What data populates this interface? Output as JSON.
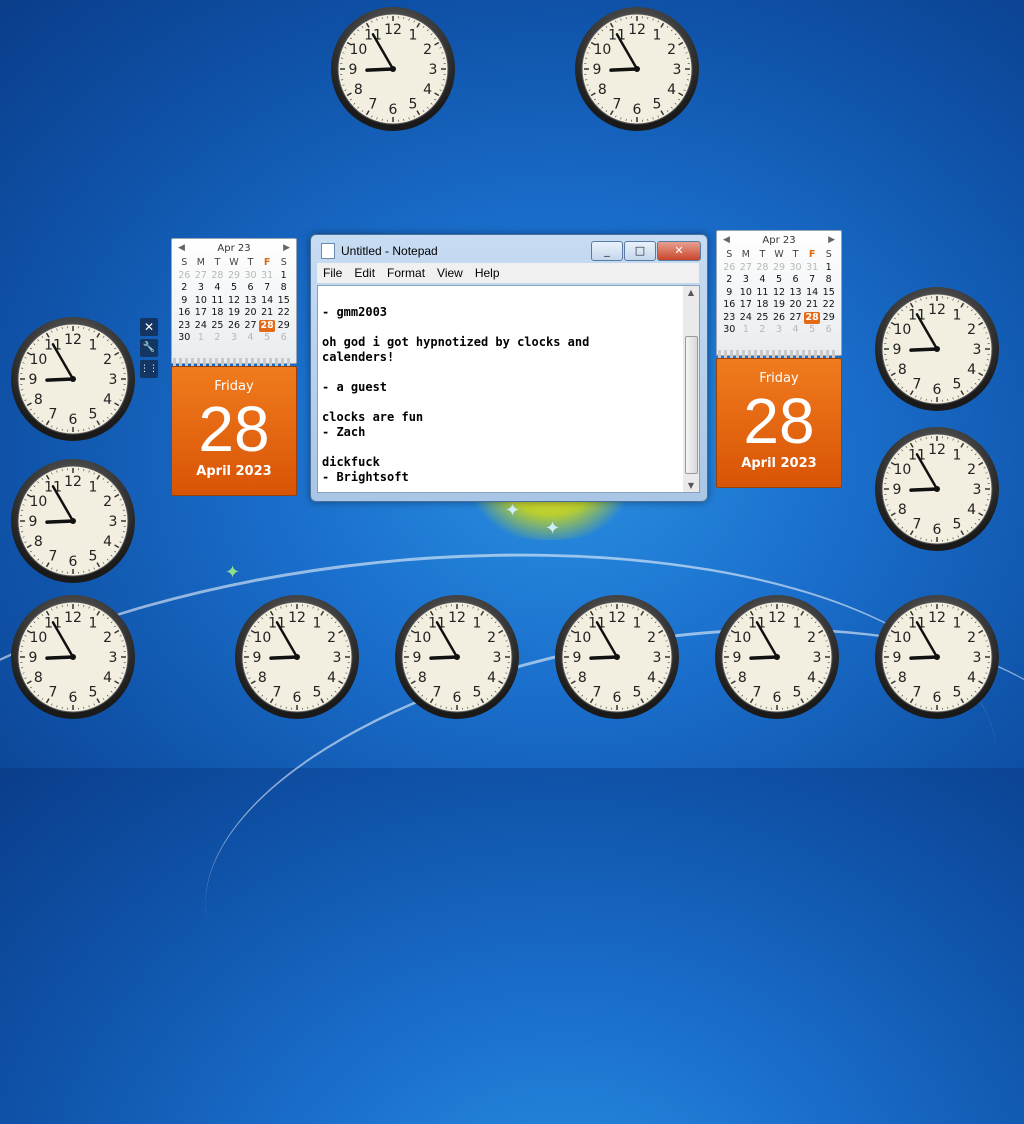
{
  "clock_numerals": [
    "12",
    "1",
    "2",
    "3",
    "4",
    "5",
    "6",
    "7",
    "8",
    "9",
    "10",
    "11"
  ],
  "clock_time": {
    "hour": 8,
    "minute": 55
  },
  "calendar_left": {
    "month_label": "Apr 23",
    "weekday_headers": [
      "S",
      "M",
      "T",
      "W",
      "T",
      "F",
      "S"
    ],
    "weeks": [
      [
        "26",
        "27",
        "28",
        "29",
        "30",
        "31",
        "1"
      ],
      [
        "2",
        "3",
        "4",
        "5",
        "6",
        "7",
        "8"
      ],
      [
        "9",
        "10",
        "11",
        "12",
        "13",
        "14",
        "15"
      ],
      [
        "16",
        "17",
        "18",
        "19",
        "20",
        "21",
        "22"
      ],
      [
        "23",
        "24",
        "25",
        "26",
        "27",
        "28",
        "29"
      ],
      [
        "30",
        "1",
        "2",
        "3",
        "4",
        "5",
        "6"
      ]
    ],
    "today": "28",
    "day_name": "Friday",
    "day_number": "28",
    "month_year": "April 2023"
  },
  "calendar_right": {
    "month_label": "Apr 23",
    "weekday_headers": [
      "S",
      "M",
      "T",
      "W",
      "T",
      "F",
      "S"
    ],
    "weeks": [
      [
        "26",
        "27",
        "28",
        "29",
        "30",
        "31",
        "1"
      ],
      [
        "2",
        "3",
        "4",
        "5",
        "6",
        "7",
        "8"
      ],
      [
        "9",
        "10",
        "11",
        "12",
        "13",
        "14",
        "15"
      ],
      [
        "16",
        "17",
        "18",
        "19",
        "20",
        "21",
        "22"
      ],
      [
        "23",
        "24",
        "25",
        "26",
        "27",
        "28",
        "29"
      ],
      [
        "30",
        "1",
        "2",
        "3",
        "4",
        "5",
        "6"
      ]
    ],
    "today": "28",
    "day_name": "Friday",
    "day_number": "28",
    "month_year": "April 2023"
  },
  "gadget_tools": {
    "close": "✕",
    "options": "🔧",
    "drag": "⋮⋮"
  },
  "notepad": {
    "title": "Untitled - Notepad",
    "menu": [
      "File",
      "Edit",
      "Format",
      "View",
      "Help"
    ],
    "buttons": {
      "minimize": "_",
      "maximize": "□",
      "close": "✕"
    },
    "content": "\n- gmm2003\n\noh god i got hypnotized by clocks and\ncalenders!\n\n- a guest\n\nclocks are fun\n- Zach\n\ndickfuck\n- Brightsoft"
  },
  "colors": {
    "accent_orange": "#e56a17",
    "desktop_blue": "#1a6fcc"
  }
}
